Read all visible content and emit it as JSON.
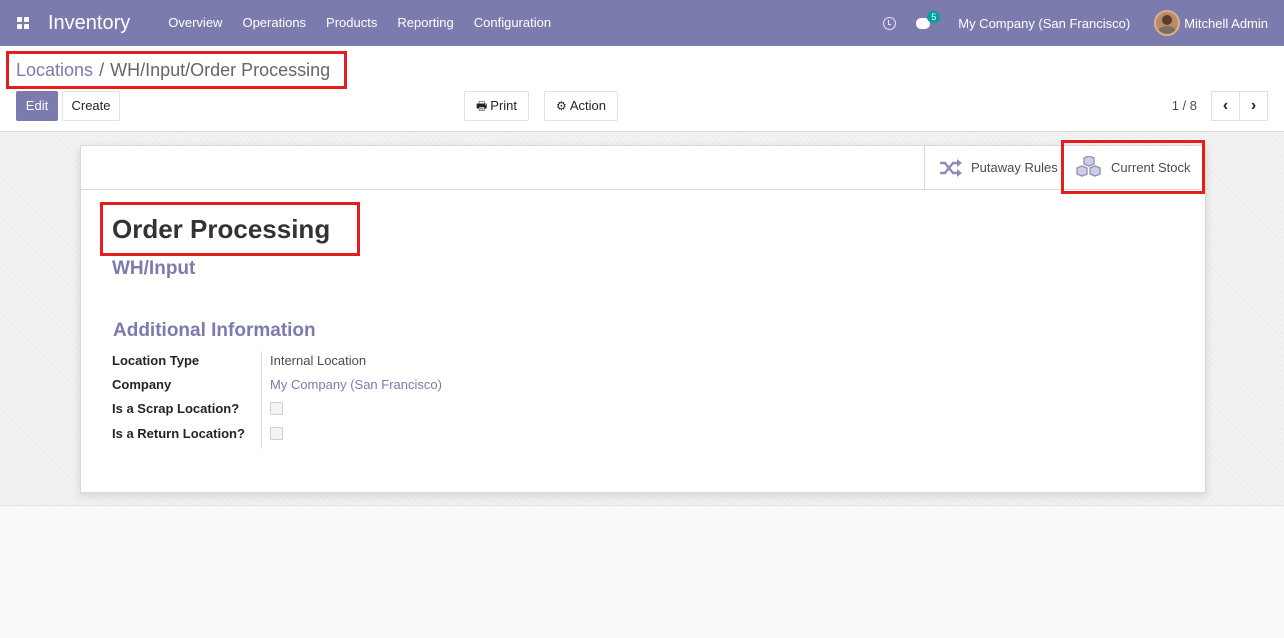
{
  "navbar": {
    "app_name": "Inventory",
    "menu": [
      "Overview",
      "Operations",
      "Products",
      "Reporting",
      "Configuration"
    ],
    "chat_badge": "5",
    "company": "My Company (San Francisco)",
    "user": "Mitchell Admin"
  },
  "breadcrumb": {
    "parent": "Locations",
    "separator": "/",
    "current": "WH/Input/Order Processing"
  },
  "toolbar": {
    "edit_label": "Edit",
    "create_label": "Create",
    "print_label": "Print",
    "action_label": "Action"
  },
  "pager": {
    "value": "1 / 8"
  },
  "smart_buttons": {
    "putaway_label": "Putaway Rules",
    "stock_label": "Current Stock"
  },
  "record": {
    "name": "Order Processing",
    "parent": "WH/Input",
    "section_title": "Additional Information",
    "fields": {
      "location_type_label": "Location Type",
      "location_type_value": "Internal Location",
      "company_label": "Company",
      "company_value": "My Company (San Francisco)",
      "scrap_label": "Is a Scrap Location?",
      "scrap_checked": false,
      "return_label": "Is a Return Location?",
      "return_checked": false
    }
  },
  "colors": {
    "brand": "#7c7bad",
    "highlight": "#e41d1d",
    "badge": "#00a09d"
  }
}
